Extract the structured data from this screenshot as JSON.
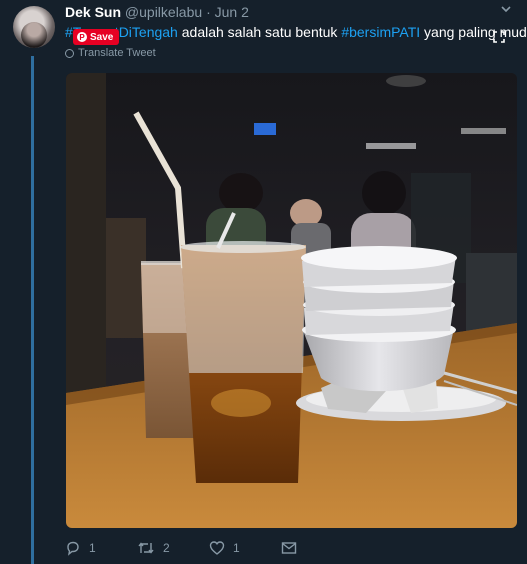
{
  "tweet": {
    "author_name": "Dek Sun",
    "author_handle": "@upilkelabu",
    "separator": "·",
    "date": "Jun 2",
    "text_parts": [
      "#TempatDiTengah",
      " adalah salah satu bentuk ",
      "#bersimPATI",
      " yang paling mudah."
    ],
    "translate_label": "Translate Tweet",
    "save_label": "Save"
  },
  "actions": {
    "reply_count": "1",
    "retweet_count": "2",
    "like_count": "1"
  },
  "icons": {
    "chevron": "chevron-down-icon",
    "reply": "reply-icon",
    "retweet": "retweet-icon",
    "like": "heart-icon",
    "dm": "envelope-icon",
    "translate": "globe-icon",
    "expand": "expand-icon",
    "save": "pinterest-icon"
  },
  "colors": {
    "background": "#15202b",
    "link": "#1da1f2",
    "muted": "#8899a6",
    "save_button": "#e60023",
    "thread_line": "#2f6fa0"
  }
}
